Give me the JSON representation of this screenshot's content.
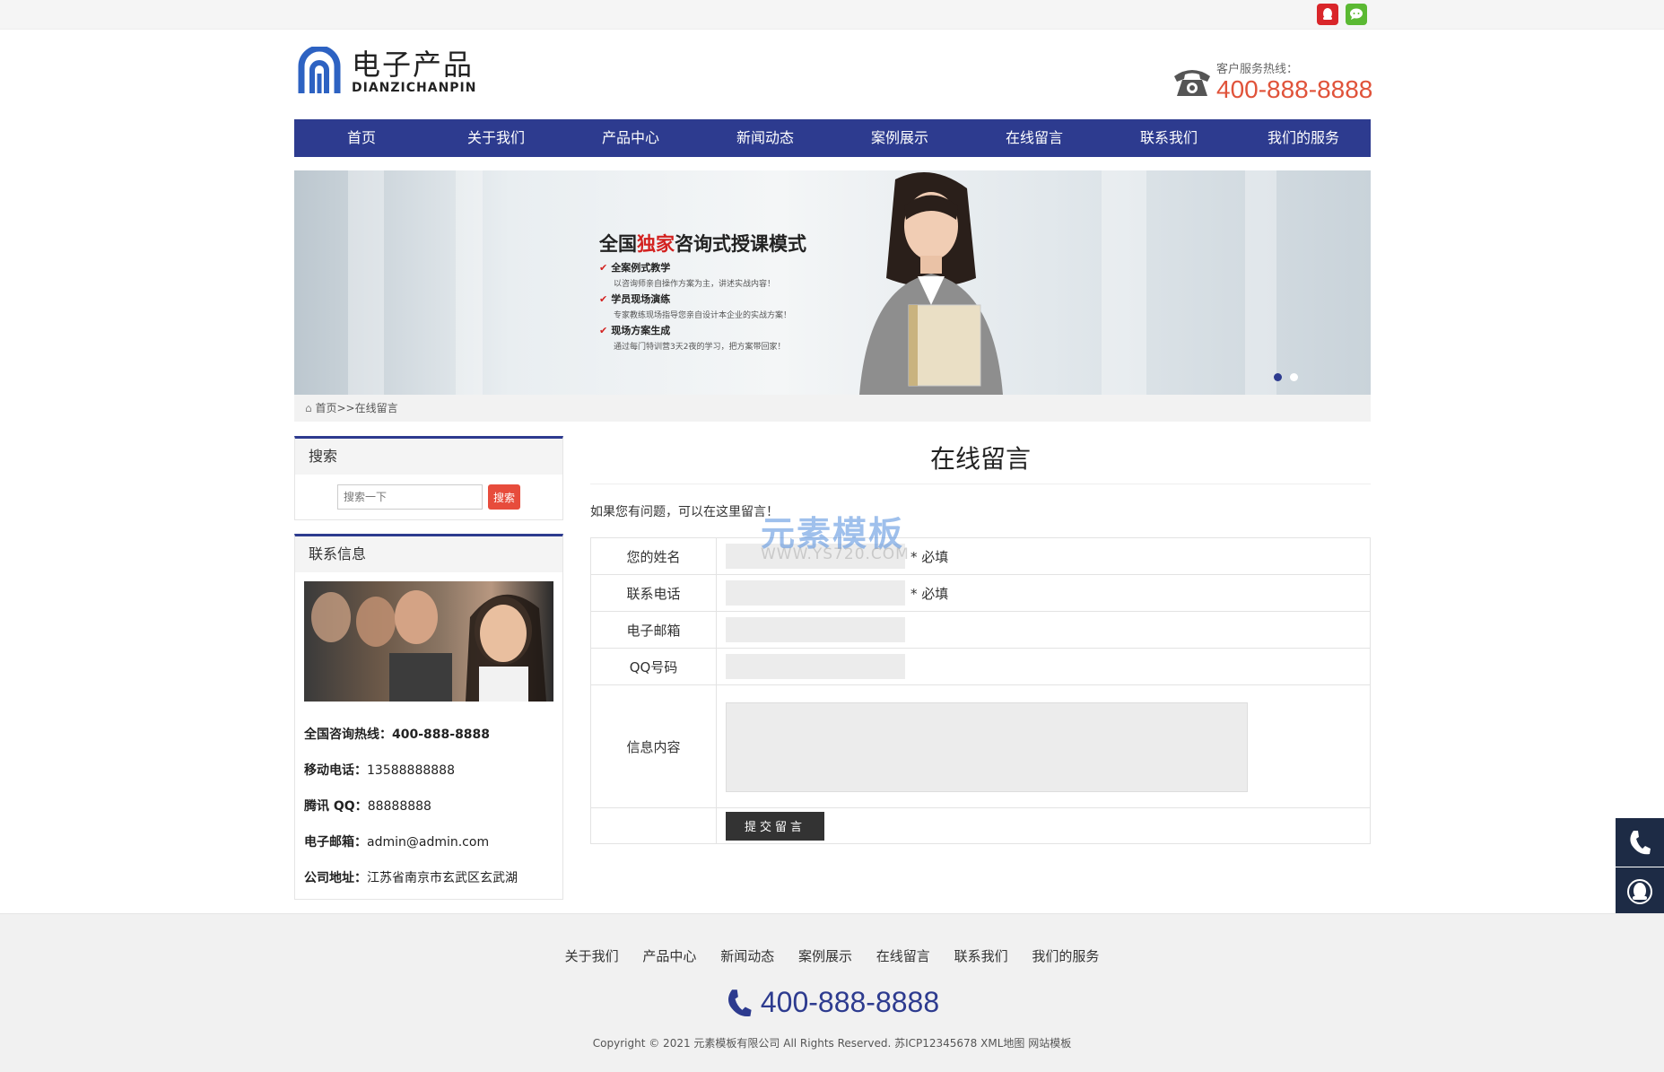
{
  "site": {
    "logo_cn": "电子产品",
    "logo_en": "DIANZICHANPIN"
  },
  "hotline": {
    "label": "客户服务热线：",
    "number": "400-888-8888"
  },
  "nav": [
    "首页",
    "关于我们",
    "产品中心",
    "新闻动态",
    "案例展示",
    "在线留言",
    "联系我们",
    "我们的服务"
  ],
  "banner": {
    "title_pre": "全国",
    "title_hl": "独家",
    "title_post": "咨询式授课模式",
    "points": [
      {
        "title": "全案例式教学",
        "desc": "以咨询师亲自操作方案为主，讲述实战内容！"
      },
      {
        "title": "学员现场演练",
        "desc": "专家教练现场指导您亲自设计本企业的实战方案！"
      },
      {
        "title": "现场方案生成",
        "desc": "通过每门特训营3天2夜的学习，把方案带回家！"
      }
    ],
    "check": "✔"
  },
  "breadcrumb": "首页>>在线留言",
  "sidebar": {
    "search_title": "搜索",
    "search_placeholder": "搜索一下",
    "search_button": "搜索",
    "contact_title": "联系信息",
    "contacts": [
      {
        "label": "全国咨询热线：",
        "value": "400-888-8888",
        "bold_value": true
      },
      {
        "label": "移动电话：",
        "value": "13588888888",
        "bold_value": false
      },
      {
        "label": "腾讯 QQ：",
        "value": "88888888",
        "bold_value": false
      },
      {
        "label": "电子邮箱：",
        "value": "admin@admin.com",
        "bold_value": false
      },
      {
        "label": "公司地址：",
        "value": "江苏省南京市玄武区玄武湖",
        "bold_value": false
      }
    ]
  },
  "main": {
    "title": "在线留言",
    "intro": "如果您有问题，可以在这里留言！",
    "fields": {
      "name": "您的姓名",
      "phone": "联系电话",
      "email": "电子邮箱",
      "qq": "QQ号码",
      "message": "信息内容"
    },
    "required": "* 必填",
    "submit": "提交留言"
  },
  "watermark": {
    "cn": "元素模板",
    "en": "WWW.YS720.COM"
  },
  "footer": {
    "links": [
      "关于我们",
      "产品中心",
      "新闻动态",
      "案例展示",
      "在线留言",
      "联系我们",
      "我们的服务"
    ],
    "phone": "400-888-8888",
    "copyright": "Copyright © 2021 元素模板有限公司 All Rights Reserved. 苏ICP12345678 XML地图 网站模板"
  },
  "colors": {
    "nav": "#2d3b8f",
    "accent": "#e0533a",
    "float": "#1d2b45"
  }
}
